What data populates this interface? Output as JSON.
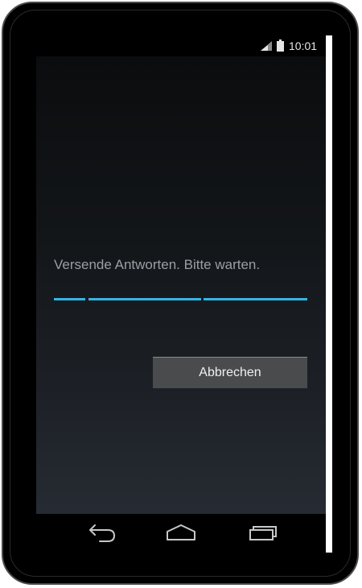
{
  "status_bar": {
    "time": "10:01",
    "signal_icon": "signal-icon",
    "battery_icon": "battery-icon"
  },
  "dialog": {
    "message": "Versende Antworten. Bitte warten.",
    "progress_indeterminate": true,
    "cancel_label": "Abbrechen"
  },
  "nav_bar": {
    "back_icon": "back-icon",
    "home_icon": "home-icon",
    "recents_icon": "recent-apps-icon"
  },
  "colors": {
    "accent": "#33b5e5",
    "button": "#4a4b4d",
    "message_text": "#9b9fa5"
  }
}
